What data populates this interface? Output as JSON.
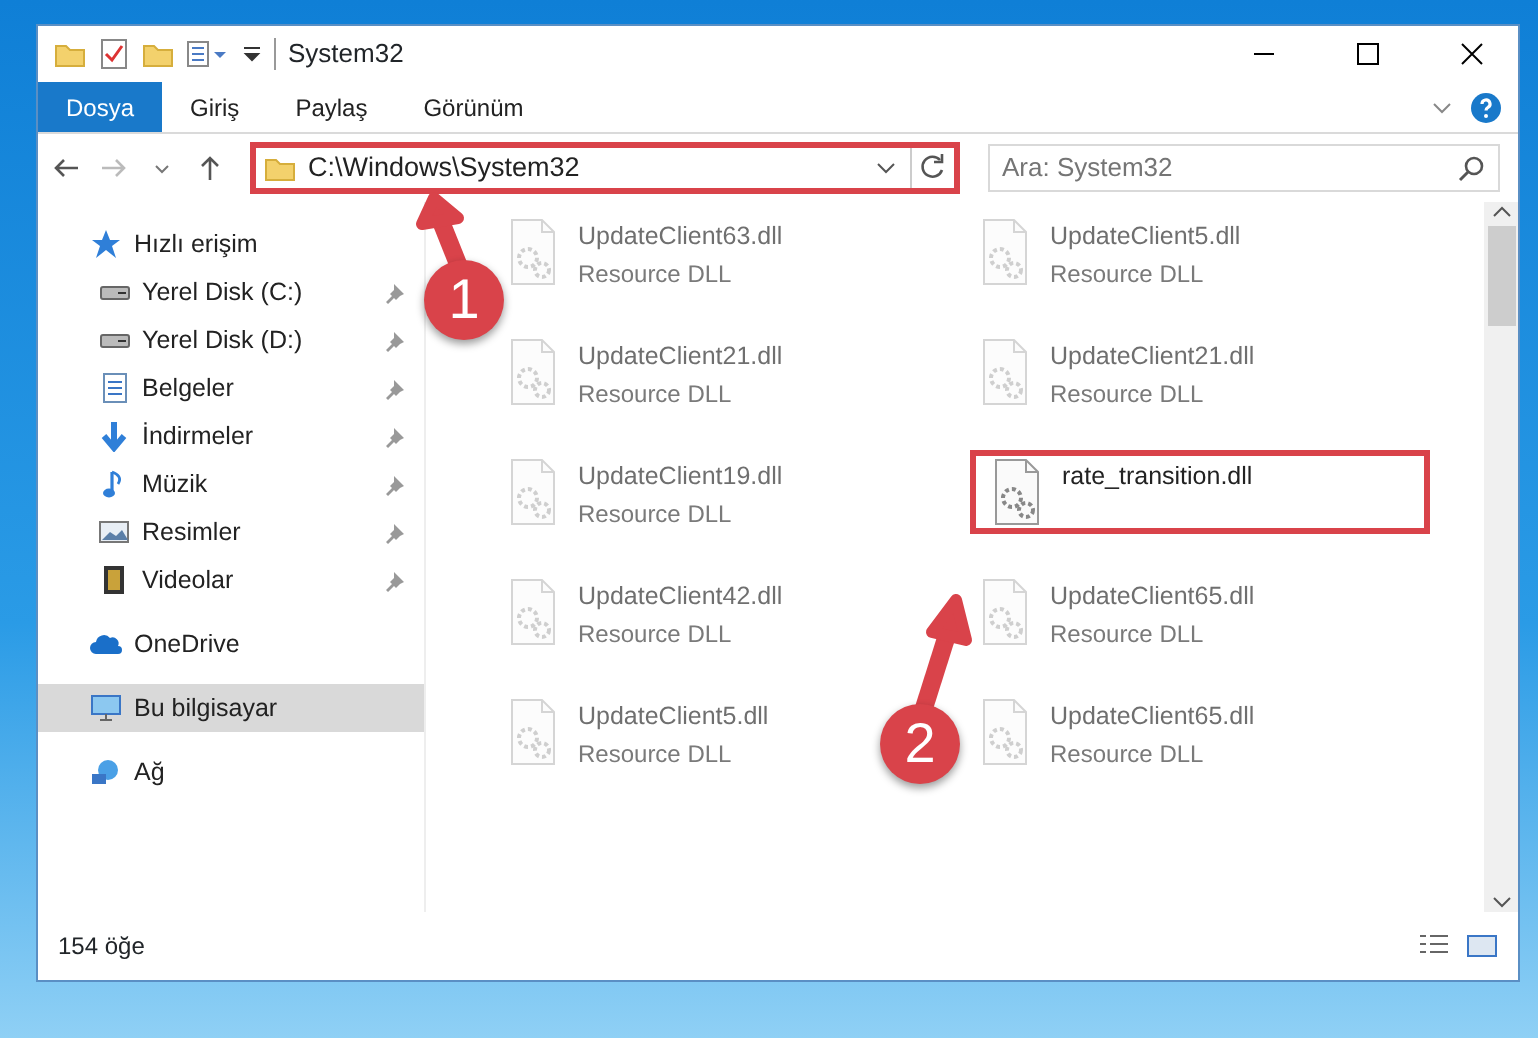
{
  "window": {
    "title": "System32"
  },
  "ribbon_tabs": [
    {
      "label": "Dosya",
      "selected": true
    },
    {
      "label": "Giriş",
      "selected": false
    },
    {
      "label": "Paylaş",
      "selected": false
    },
    {
      "label": "Görünüm",
      "selected": false
    }
  ],
  "address": {
    "path": "C:\\Windows\\System32",
    "highlighted": true
  },
  "search": {
    "placeholder": "Ara: System32"
  },
  "sidebar": {
    "items": [
      {
        "label": "Hızlı erişim",
        "kind": "star",
        "selected": false,
        "children": [
          {
            "label": "Yerel Disk (C:)",
            "kind": "drive",
            "pinned": true,
            "selected": false
          },
          {
            "label": "Yerel Disk (D:)",
            "kind": "drive",
            "pinned": true,
            "selected": false
          },
          {
            "label": "Belgeler",
            "kind": "document",
            "pinned": true,
            "selected": false
          },
          {
            "label": "İndirmeler",
            "kind": "download",
            "pinned": true,
            "selected": false
          },
          {
            "label": "Müzik",
            "kind": "music",
            "pinned": true,
            "selected": false
          },
          {
            "label": "Resimler",
            "kind": "picture",
            "pinned": true,
            "selected": false
          },
          {
            "label": "Videolar",
            "kind": "video",
            "pinned": true,
            "selected": false
          }
        ]
      },
      {
        "label": "OneDrive",
        "kind": "cloud",
        "selected": false
      },
      {
        "label": "Bu bilgisayar",
        "kind": "computer",
        "selected": true
      },
      {
        "label": "Ağ",
        "kind": "network",
        "selected": false
      }
    ]
  },
  "files": [
    {
      "name": "UpdateClient63.dll",
      "type": "Resource DLL",
      "faded": true,
      "highlighted": false
    },
    {
      "name": "UpdateClient5.dll",
      "type": "Resource DLL",
      "faded": true,
      "highlighted": false
    },
    {
      "name": "UpdateClient21.dll",
      "type": "Resource DLL",
      "faded": true,
      "highlighted": false
    },
    {
      "name": "UpdateClient21.dll",
      "type": "Resource DLL",
      "faded": true,
      "highlighted": false
    },
    {
      "name": "UpdateClient19.dll",
      "type": "Resource DLL",
      "faded": true,
      "highlighted": false
    },
    {
      "name": "rate_transition.dll",
      "faded": false,
      "highlighted": true
    },
    {
      "name": "UpdateClient42.dll",
      "type": "Resource DLL",
      "faded": true,
      "highlighted": false
    },
    {
      "name": "UpdateClient65.dll",
      "type": "Resource DLL",
      "faded": true,
      "highlighted": false
    },
    {
      "name": "UpdateClient5.dll",
      "type": "Resource DLL",
      "faded": true,
      "highlighted": false
    },
    {
      "name": "UpdateClient65.dll",
      "type": "Resource DLL",
      "faded": true,
      "highlighted": false
    }
  ],
  "annotations": [
    {
      "number": "1"
    },
    {
      "number": "2"
    }
  ],
  "status_bar": {
    "count": "154 öğe"
  }
}
